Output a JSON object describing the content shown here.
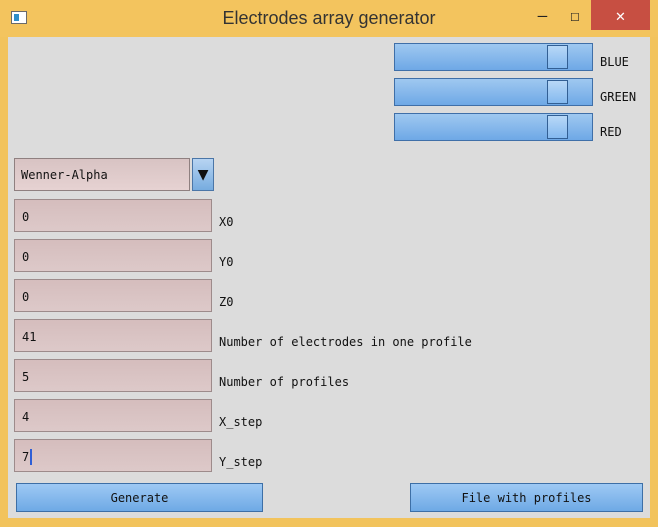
{
  "window": {
    "title": "Electrodes array generator",
    "controls": {
      "minimize": "—",
      "maximize": "☐",
      "close": "✕"
    }
  },
  "sliders": [
    {
      "label": "BLUE",
      "value_fraction": 0.8
    },
    {
      "label": "GREEN",
      "value_fraction": 0.8
    },
    {
      "label": "RED",
      "value_fraction": 0.8
    }
  ],
  "array_type": {
    "selected": "Wenner-Alpha",
    "icon": "dropdown-triangle"
  },
  "fields": [
    {
      "value": "0",
      "label": "X0"
    },
    {
      "value": "0",
      "label": "Y0"
    },
    {
      "value": "0",
      "label": "Z0"
    },
    {
      "value": "41",
      "label": "Number of electrodes in one profile"
    },
    {
      "value": "5",
      "label": "Number of profiles"
    },
    {
      "value": "4",
      "label": "X_step"
    },
    {
      "value": "7",
      "label": "Y_step"
    }
  ],
  "buttons": {
    "generate": "Generate",
    "file_with_profiles": "File with profiles"
  },
  "colors": {
    "window_frame": "#f2c35c",
    "client_bg": "#dcdcdc",
    "accent_blue": "#7fb4ea",
    "field_bg": "#d9c4c4",
    "close_button": "#c74f42"
  }
}
